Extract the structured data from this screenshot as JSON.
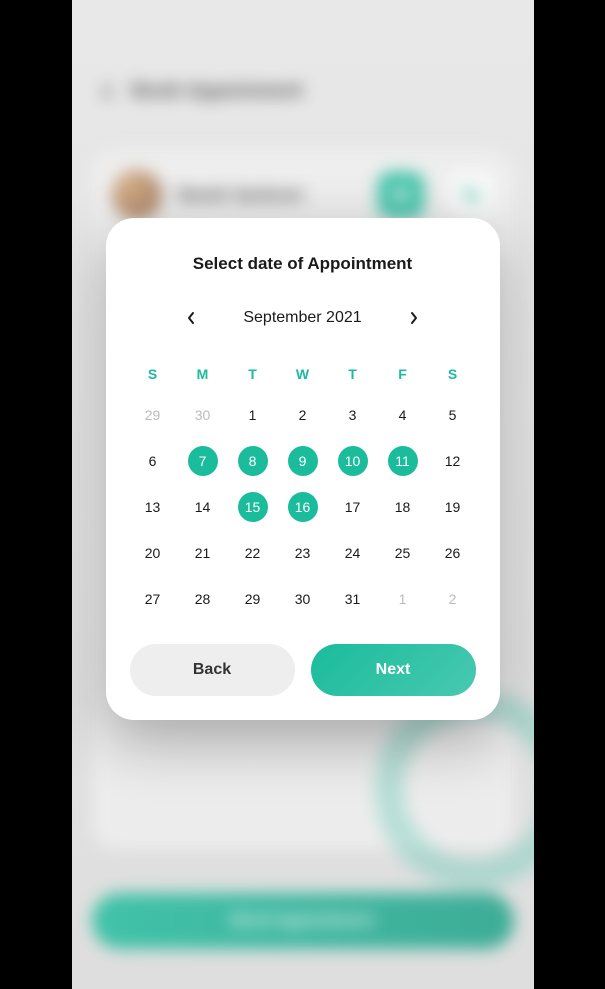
{
  "background": {
    "header_title": "Book Appoinment",
    "doctor_name": "David Jackson",
    "book_button": "Book Appointment"
  },
  "modal": {
    "title": "Select date of Appointment",
    "month_label": "September 2021",
    "day_headers": [
      "S",
      "M",
      "T",
      "W",
      "T",
      "F",
      "S"
    ],
    "days": [
      {
        "n": "29",
        "prev": true
      },
      {
        "n": "30",
        "prev": true
      },
      {
        "n": "1"
      },
      {
        "n": "2"
      },
      {
        "n": "3"
      },
      {
        "n": "4"
      },
      {
        "n": "5"
      },
      {
        "n": "6"
      },
      {
        "n": "7",
        "selected": true
      },
      {
        "n": "8",
        "selected": true
      },
      {
        "n": "9",
        "selected": true
      },
      {
        "n": "10",
        "selected": true
      },
      {
        "n": "11",
        "selected": true
      },
      {
        "n": "12"
      },
      {
        "n": "13"
      },
      {
        "n": "14"
      },
      {
        "n": "15",
        "selected": true
      },
      {
        "n": "16",
        "selected": true
      },
      {
        "n": "17"
      },
      {
        "n": "18"
      },
      {
        "n": "19"
      },
      {
        "n": "20"
      },
      {
        "n": "21"
      },
      {
        "n": "22"
      },
      {
        "n": "23"
      },
      {
        "n": "24"
      },
      {
        "n": "25"
      },
      {
        "n": "26"
      },
      {
        "n": "27"
      },
      {
        "n": "28"
      },
      {
        "n": "29"
      },
      {
        "n": "30"
      },
      {
        "n": "31"
      },
      {
        "n": "1",
        "next": true
      },
      {
        "n": "2",
        "next": true
      }
    ],
    "back_label": "Back",
    "next_label": "Next"
  },
  "colors": {
    "accent": "#1abc9c"
  }
}
